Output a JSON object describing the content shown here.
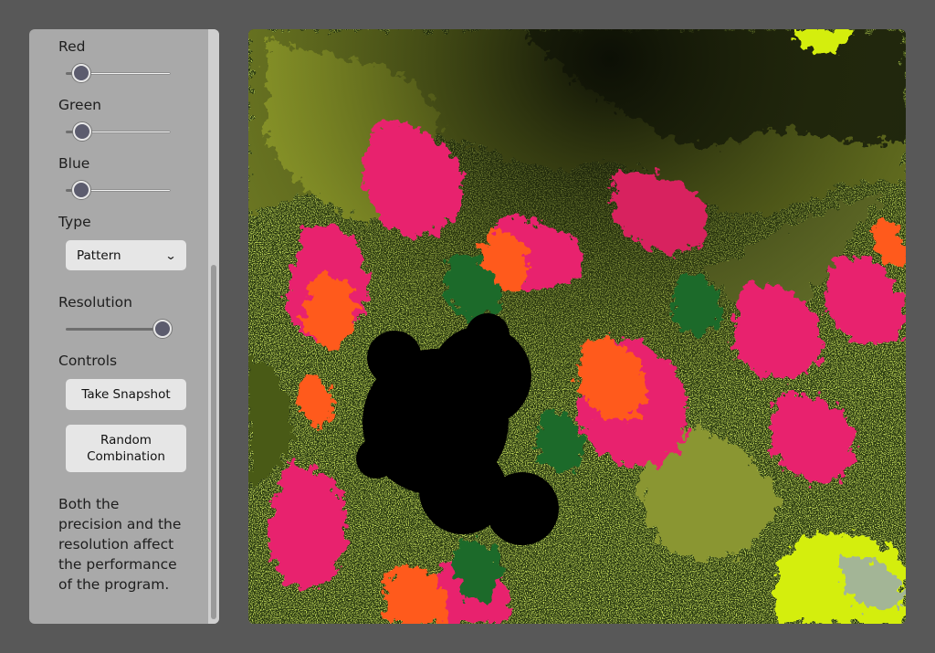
{
  "controls": {
    "red": {
      "label": "Red",
      "value_fraction": 0.15
    },
    "green": {
      "label": "Green",
      "value_fraction": 0.16
    },
    "blue": {
      "label": "Blue",
      "value_fraction": 0.15
    },
    "type": {
      "label": "Type",
      "selected": "Pattern"
    },
    "resolution": {
      "label": "Resolution",
      "value_fraction": 0.92
    },
    "controls_label": "Controls",
    "snapshot_button": "Take Snapshot",
    "random_button_line1": "Random",
    "random_button_line2": "Combination",
    "help_text": "Both the precision and the resolution affect the performance of the program."
  },
  "palette": {
    "background": "#585858",
    "panel": "#a9a9a9",
    "fractal_colors": [
      "#9aa12a",
      "#e8246e",
      "#ff5a1a",
      "#1f7a2a",
      "#d4ee10",
      "#000000"
    ]
  }
}
